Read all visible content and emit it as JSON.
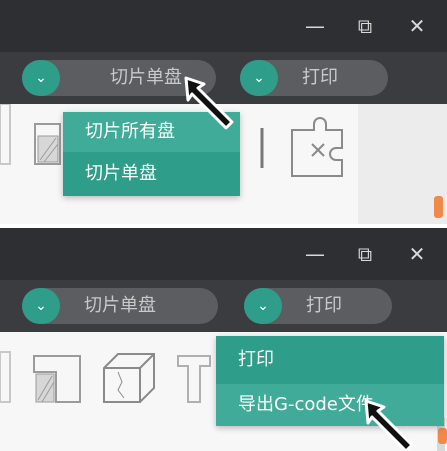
{
  "window_controls": {
    "minimize": "—",
    "maximize": "⧉",
    "close": "✕"
  },
  "panel1": {
    "slice_dropdown": {
      "chevron": "⌄",
      "label": "切片单盘"
    },
    "print_dropdown": {
      "chevron": "⌄",
      "label": "打印"
    },
    "menu_items": [
      "切片所有盘",
      "切片单盘"
    ]
  },
  "panel2": {
    "slice_dropdown": {
      "chevron": "⌄",
      "label": "切片单盘"
    },
    "print_dropdown": {
      "chevron": "⌄",
      "label": "打印"
    },
    "menu_items": [
      "打印",
      "导出G-code文件"
    ]
  },
  "colors": {
    "accent": "#2e9d8a",
    "titlebar": "#2d2f33",
    "toolbar": "#3a3c40",
    "pill": "#5b5d61"
  }
}
